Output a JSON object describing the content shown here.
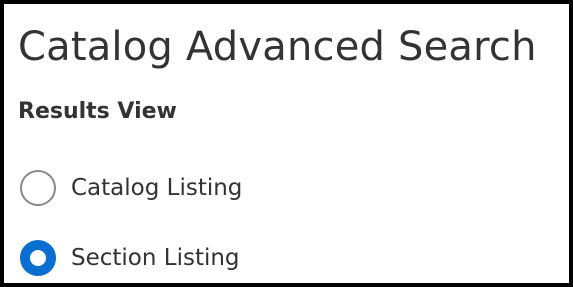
{
  "page": {
    "title": "Catalog Advanced Search"
  },
  "results_view": {
    "heading": "Results View",
    "options": [
      {
        "label": "Catalog Listing",
        "checked": false
      },
      {
        "label": "Section Listing",
        "checked": true
      }
    ]
  },
  "colors": {
    "frame_border": "#000000",
    "text": "#333333",
    "radio_selected": "#0a6ed1",
    "radio_unselected_border": "#8a8a8a"
  }
}
